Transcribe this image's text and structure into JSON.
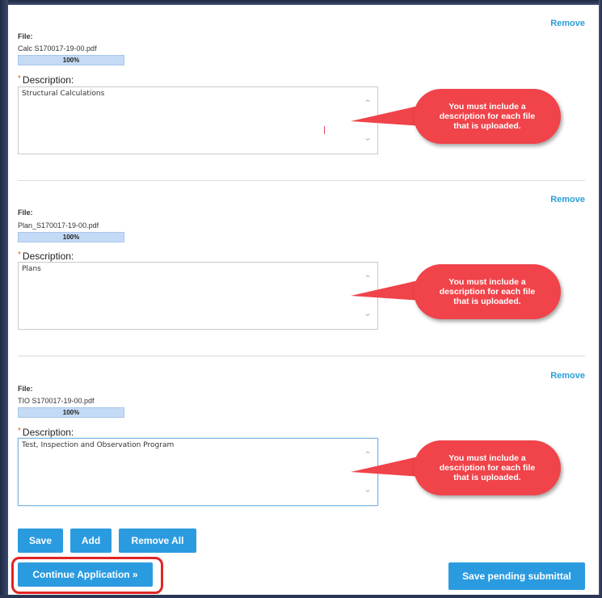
{
  "files": [
    {
      "remove_label": "Remove",
      "file_label": "File:",
      "file_name": "Calc S170017-19-00.pdf",
      "progress_text": "100%",
      "progress_value": 1.0,
      "description_label": "Description:",
      "description_value": "Structural Calculations",
      "callout_text": "You must include a description for each file that is uploaded."
    },
    {
      "remove_label": "Remove",
      "file_label": "File:",
      "file_name": "Plan_S170017-19-00.pdf",
      "progress_text": "100%",
      "progress_value": 1.0,
      "description_label": "Description:",
      "description_value": "Plans",
      "callout_text": "You must include a description for each file that is uploaded."
    },
    {
      "remove_label": "Remove",
      "file_label": "File:",
      "file_name": "TIO S170017-19-00.pdf",
      "progress_text": "100%",
      "progress_value": 1.0,
      "description_label": "Description:",
      "description_value": "Test, Inspection and Observation Program",
      "callout_text": "You must include a description for each file that is uploaded."
    }
  ],
  "required_marker": "*",
  "buttons": {
    "save": "Save",
    "add": "Add",
    "remove_all": "Remove All",
    "continue": "Continue Application »",
    "save_pending": "Save pending submittal"
  },
  "colors": {
    "accent": "#2b9be0",
    "callout": "#f0434a",
    "highlight": "#e02424",
    "link": "#2a9fd6"
  }
}
